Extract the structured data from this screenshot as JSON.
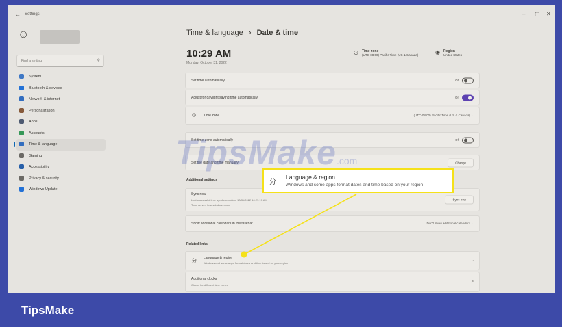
{
  "window": {
    "title": "Settings",
    "back": "←",
    "controls": [
      "–",
      "▢",
      "✕"
    ]
  },
  "sidebar": {
    "search_placeholder": "Find a setting",
    "items": [
      {
        "label": "System",
        "color": "#3a7bd5",
        "active": false
      },
      {
        "label": "Bluetooth & devices",
        "color": "#1a73e8",
        "active": false
      },
      {
        "label": "Network & internet",
        "color": "#2b6fcf",
        "active": false
      },
      {
        "label": "Personalization",
        "color": "#8a5a3c",
        "active": false
      },
      {
        "label": "Apps",
        "color": "#4a5a78",
        "active": false
      },
      {
        "label": "Accounts",
        "color": "#2e9e5b",
        "active": false
      },
      {
        "label": "Time & language",
        "color": "#2b6fcf",
        "active": true
      },
      {
        "label": "Gaming",
        "color": "#6a6a6a",
        "active": false
      },
      {
        "label": "Accessibility",
        "color": "#1f5fb5",
        "active": false
      },
      {
        "label": "Privacy & security",
        "color": "#6a6a6a",
        "active": false
      },
      {
        "label": "Windows Update",
        "color": "#1a73e8",
        "active": false
      }
    ]
  },
  "header": {
    "breadcrumb_parent": "Time & language",
    "breadcrumb_sep": "›",
    "breadcrumb_current": "Date & time",
    "time": "10:29 AM",
    "date": "Monday, October 31, 2022",
    "timezone_title": "Time zone",
    "timezone_value": "(UTC-08:00) Pacific Time (US & Canada)",
    "region_title": "Region",
    "region_value": "United States"
  },
  "settings": {
    "set_time_auto": {
      "label": "Set time automatically",
      "state": "Off"
    },
    "dst": {
      "label": "Adjust for daylight saving time automatically",
      "state": "On"
    },
    "timezone": {
      "label": "Time zone",
      "value": "(UTC-08:00) Pacific Time (US & Canada)"
    },
    "set_tz_auto": {
      "label": "Set time zone automatically",
      "state": "Off"
    },
    "manual": {
      "label": "Set the date and time manually",
      "button": "Change"
    },
    "additional_settings": "Additional settings",
    "sync": {
      "title": "Sync now",
      "line1": "Last successful time synchronization: 10/31/2022 10:27:17 AM",
      "line2": "Time server: time.windows.com",
      "button": "Sync now"
    },
    "calendars": {
      "label": "Show additional calendars in the taskbar",
      "value": "Don't show additional calendars"
    },
    "related_links": "Related links",
    "lang_region": {
      "title": "Language & region",
      "sub": "Windows and some apps format dates and time based on your region"
    },
    "clocks": {
      "title": "Additional clocks",
      "sub": "Clocks for different time zones"
    }
  },
  "callout": {
    "title": "Language & region",
    "sub": "Windows and some apps format dates and time based on your region",
    "icon": "language-icon"
  },
  "watermark": {
    "text": "TipsMake",
    "suffix": ".com"
  },
  "footer": {
    "brand": "TipsMake"
  },
  "colors": {
    "accent": "#5b3fbf",
    "highlight": "#f5e11a",
    "brand_bg": "#3d4aa8"
  }
}
